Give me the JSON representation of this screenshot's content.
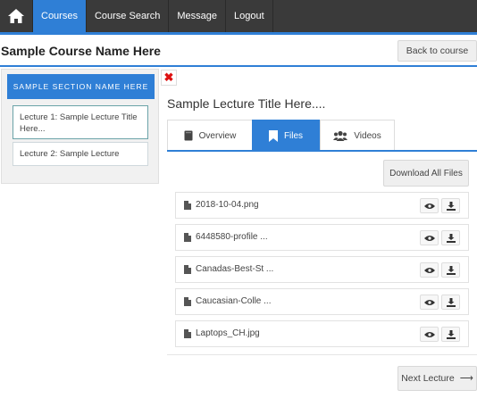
{
  "nav": {
    "items": [
      {
        "label": "Courses",
        "active": true
      },
      {
        "label": "Course Search",
        "active": false
      },
      {
        "label": "Message",
        "active": false
      },
      {
        "label": "Logout",
        "active": false
      }
    ]
  },
  "header": {
    "course_name": "Sample Course Name Here",
    "back_label": "Back to course"
  },
  "sidebar": {
    "section_name": "SAMPLE SECTION NAME HERE",
    "lectures": [
      {
        "label": "Lecture 1: Sample Lecture Title Here...",
        "active": true
      },
      {
        "label": "Lecture 2: Sample Lecture",
        "active": false
      }
    ]
  },
  "content": {
    "close_glyph": "✖",
    "lecture_title": "Sample Lecture Title Here....",
    "tabs": [
      {
        "label": "Overview",
        "icon": "book-icon",
        "active": false
      },
      {
        "label": "Files",
        "icon": "bookmark-icon",
        "active": true
      },
      {
        "label": "Videos",
        "icon": "users-icon",
        "active": false
      }
    ],
    "download_all_label": "Download All Files",
    "files": [
      {
        "name": "2018-10-04.png"
      },
      {
        "name": "6448580-profile ..."
      },
      {
        "name": "Canadas-Best-St ..."
      },
      {
        "name": "Caucasian-Colle ..."
      },
      {
        "name": "Laptops_CH.jpg"
      }
    ],
    "next_label": "Next Lecture",
    "next_arrow": "⟶"
  },
  "colors": {
    "accent": "#2f7fd6",
    "nav_bg": "#3a3a3a",
    "close": "#d11111"
  }
}
